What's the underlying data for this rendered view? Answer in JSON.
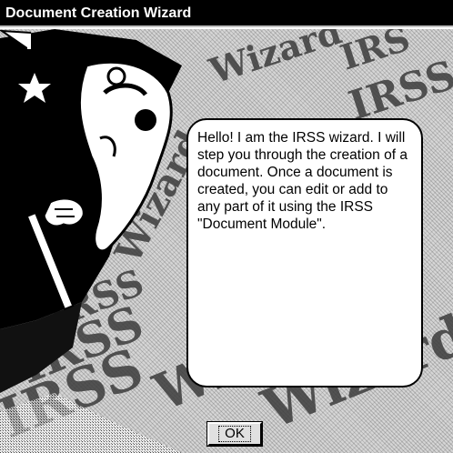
{
  "window": {
    "title": "Document Creation Wizard"
  },
  "art": {
    "background_words": [
      "IRSS",
      "Wizard",
      "IRSS",
      "Wizard",
      "IRSS",
      "Wizard",
      "IRSS",
      "Wizard"
    ],
    "colors": {
      "dither_light": "#d6d6d6",
      "wizard_robe": "#000000",
      "beard": "#ffffff"
    }
  },
  "bubble": {
    "text": "Hello! I am the IRSS wizard.  I will step you through the creation of a document.  Once a document is created, you can edit or add to any part of it using the IRSS \"Document Module\"."
  },
  "buttons": {
    "ok_label": "OK"
  }
}
